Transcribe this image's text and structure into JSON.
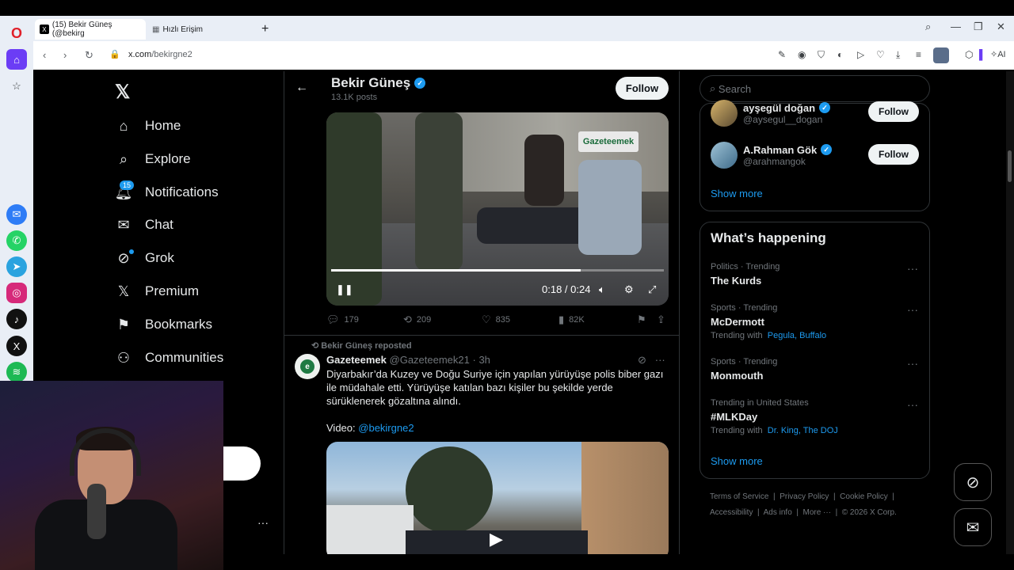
{
  "browser": {
    "tabs": [
      {
        "label": "(15) Bekir Güneş (@bekirg",
        "active": true
      },
      {
        "label": "Hızlı Erişim",
        "active": false
      }
    ],
    "url_host": "x.com",
    "url_path": "/bekirgne2"
  },
  "sidebar": {
    "items": [
      {
        "label": "Home"
      },
      {
        "label": "Explore"
      },
      {
        "label": "Notifications",
        "badge": "15"
      },
      {
        "label": "Chat"
      },
      {
        "label": "Grok"
      },
      {
        "label": "Premium"
      },
      {
        "label": "Bookmarks"
      },
      {
        "label": "Communities"
      }
    ],
    "more": "···"
  },
  "profile_header": {
    "name": "Bekir Güneş",
    "posts": "13.1K posts",
    "follow": "Follow"
  },
  "tweet1": {
    "video": {
      "watermark": "Gazeteemek",
      "time": "0:18 / 0:24",
      "progress": 0.75
    },
    "actions": {
      "replies": "179",
      "reposts": "209",
      "likes": "835",
      "views": "82K"
    }
  },
  "tweet2": {
    "repost_label": "Bekir Güneş reposted",
    "name": "Gazeteemek",
    "handle": "@Gazeteemek21",
    "time": "· 3h",
    "text": "Diyarbakır’da Kuzey ve Doğu Suriye için yapılan yürüyüşe polis biber gazı ile müdahale etti. Yürüyüşe katılan bazı kişiler bu şekilde yerde sürüklenerek gözaltına alındı.",
    "video_label": "Video:",
    "video_mention": "@bekirgne2"
  },
  "right": {
    "search_placeholder": "Search",
    "who_to_follow": [
      {
        "name": "ayşegül doğan",
        "handle": "@aysegul__dogan",
        "follow": "Follow"
      },
      {
        "name": "A.Rahman Gök",
        "handle": "@arahmangok",
        "follow": "Follow"
      }
    ],
    "show_more": "Show more",
    "whats_happening": {
      "title": "What’s happening",
      "trends": [
        {
          "context": "Politics · Trending",
          "title": "The Kurds",
          "with_label": "",
          "with_links": ""
        },
        {
          "context": "Sports · Trending",
          "title": "McDermott",
          "with_label": "Trending with",
          "with_links": "Pegula, Buffalo"
        },
        {
          "context": "Sports · Trending",
          "title": "Monmouth",
          "with_label": "",
          "with_links": ""
        },
        {
          "context": "Trending in United States",
          "title": "#MLKDay",
          "with_label": "Trending with",
          "with_links": "Dr. King, The DOJ"
        }
      ],
      "show_more": "Show more"
    },
    "footer": {
      "line1": [
        "Terms of Service",
        "Privacy Policy",
        "Cookie Policy"
      ],
      "line2": [
        "Accessibility",
        "Ads info",
        "More ···",
        "© 2026 X Corp."
      ]
    }
  },
  "icons": {
    "back": "←",
    "pause": "❚❚",
    "mute": "🔇",
    "settings": "⚙",
    "fullscreen": "⤢",
    "play": "▶"
  },
  "colors": {
    "accent": "#1d9bf0",
    "background": "#000000",
    "text": "#e7e9ea",
    "muted": "#71767b"
  }
}
